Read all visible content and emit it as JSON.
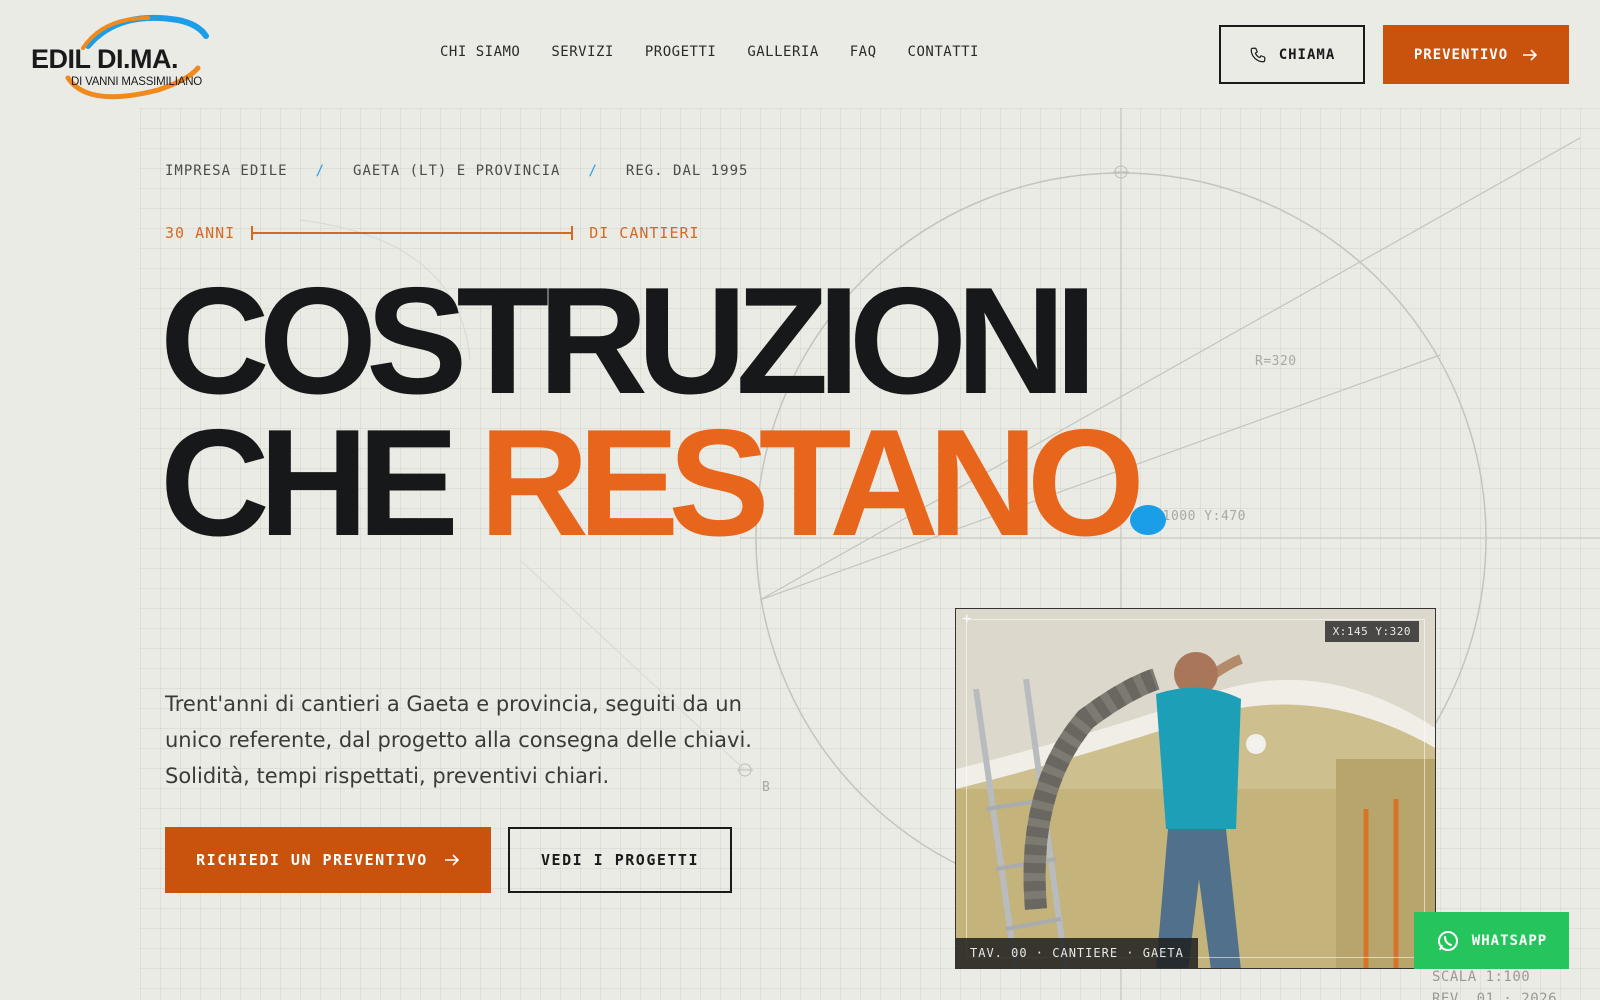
{
  "brand": {
    "name": "EDIL DI.MA.",
    "subtitle": "DI VANNI MASSIMILIANO"
  },
  "nav": {
    "items": [
      "CHI SIAMO",
      "SERVIZI",
      "PROGETTI",
      "GALLERIA",
      "FAQ",
      "CONTATTI"
    ]
  },
  "header": {
    "call_label": "CHIAMA",
    "quote_label": "PREVENTIVO"
  },
  "hero": {
    "breadcrumb": [
      "IMPRESA EDILE",
      "GAETA (LT) E PROVINCIA",
      "REG. DAL 1995"
    ],
    "breadcrumb_sep": "/",
    "years_left": "30 ANNI",
    "years_right": "DI CANTIERI",
    "headline_line1": "COSTRUZIONI",
    "headline_line2_plain": "CHE ",
    "headline_line2_accent": "RESTANO",
    "lead": "Trent'anni di cantieri a Gaeta e provincia, seguiti da un unico referente, dal progetto alla consegna delle chiavi. Solidità, tempi rispettati, preventivi chiari.",
    "cta_primary": "RICHIEDI UN PREVENTIVO",
    "cta_secondary": "VEDI I PROGETTI"
  },
  "blueprint": {
    "radius_label": "R=320",
    "coord_label": "X:1000 Y:470",
    "point_label": "B"
  },
  "photo": {
    "coord_tag": "X:145 Y:320",
    "caption": "TAV. 00 · CANTIERE · GAETA"
  },
  "whatsapp": {
    "label": "WHATSAPP"
  },
  "footer_labels": {
    "scale": "SCALA 1:100",
    "rev": "REV. 01 · 2026"
  },
  "colors": {
    "background": "#ebebe6",
    "accent_orange": "#e8661c",
    "button_orange": "#c9520d",
    "blue_dot": "#1a9ee8",
    "whatsapp_green": "#25c45c"
  },
  "icons": {
    "call": "phone-icon",
    "arrow": "arrow-right-icon",
    "whatsapp": "whatsapp-icon"
  }
}
